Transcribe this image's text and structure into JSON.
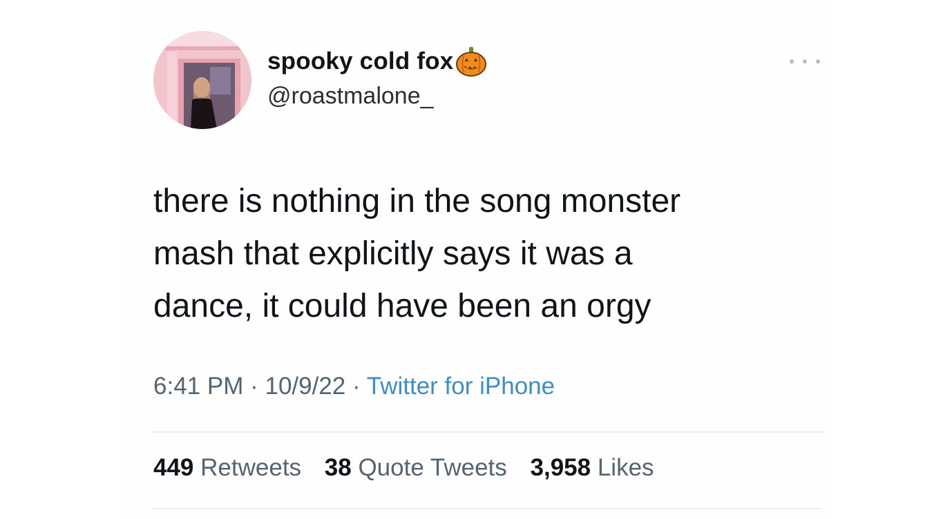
{
  "author": {
    "display_name": "spooky cold fox",
    "name_emoji": "jack-o-lantern-icon",
    "handle": "@roastmalone_"
  },
  "tweet": {
    "text_lines": [
      "there is nothing in the song monster",
      "mash that explicitly says it was a",
      "dance, it could have been an orgy"
    ],
    "time": "6:41 PM",
    "date": "10/9/22",
    "separator": "·",
    "source": "Twitter for iPhone"
  },
  "stats": {
    "retweets_count": "449",
    "retweets_label": "Retweets",
    "quotes_count": "38",
    "quotes_label": "Quote Tweets",
    "likes_count": "3,958",
    "likes_label": "Likes"
  },
  "colors": {
    "text_primary": "#0f1419",
    "text_secondary": "#536471",
    "source_link": "#3a8fc6",
    "pumpkin": "#f08c1c"
  }
}
